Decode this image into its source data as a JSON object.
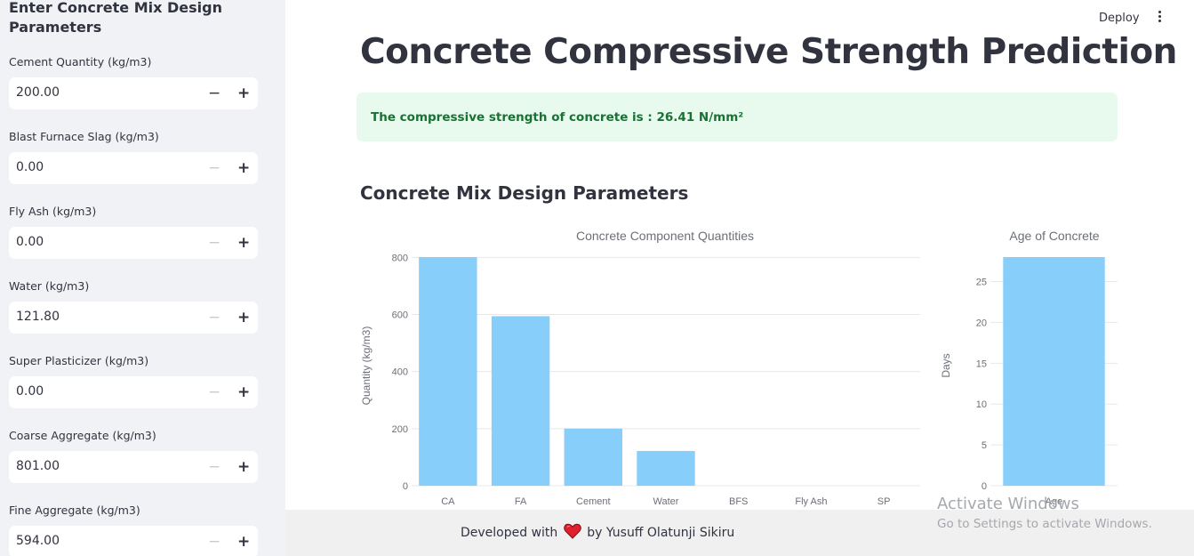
{
  "sidebar": {
    "title": "Enter Concrete Mix Design Parameters",
    "fields": [
      {
        "label": "Cement Quantity (kg/m3)",
        "value": "200.00",
        "minus": "−",
        "plus": "+"
      },
      {
        "label": "Blast Furnace Slag (kg/m3)",
        "value": "0.00",
        "minus": "−",
        "plus": "+"
      },
      {
        "label": "Fly Ash (kg/m3)",
        "value": "0.00",
        "minus": "−",
        "plus": "+"
      },
      {
        "label": "Water (kg/m3)",
        "value": "121.80",
        "minus": "−",
        "plus": "+"
      },
      {
        "label": "Super Plasticizer (kg/m3)",
        "value": "0.00",
        "minus": "−",
        "plus": "+"
      },
      {
        "label": "Coarse Aggregate (kg/m3)",
        "value": "801.00",
        "minus": "−",
        "plus": "+"
      },
      {
        "label": "Fine Aggregate (kg/m3)",
        "value": "594.00",
        "minus": "−",
        "plus": "+"
      }
    ]
  },
  "header": {
    "deploy_label": "Deploy",
    "menu_icon": "kebab-menu-icon"
  },
  "main": {
    "title": "Concrete Compressive Strength Prediction",
    "result": "The compressive strength of concrete is : 26.41 N/mm²",
    "section_title": "Concrete Mix Design Parameters"
  },
  "colors": {
    "bar": "#87cefa",
    "success_bg": "#e8f9ee",
    "success_text": "#177233",
    "sidebar_bg": "#f0f2f6"
  },
  "chart_data": [
    {
      "type": "bar",
      "title": "Concrete Component Quantities",
      "xlabel": "",
      "ylabel": "Quantity (kg/m3)",
      "categories": [
        "CA",
        "FA",
        "Cement",
        "Water",
        "BFS",
        "Fly Ash",
        "SP"
      ],
      "values": [
        801,
        594,
        200,
        121.8,
        0,
        0,
        0
      ],
      "ylim": [
        0,
        801
      ],
      "yticks": [
        0,
        200,
        400,
        600,
        800
      ],
      "grid": true
    },
    {
      "type": "bar",
      "title": "Age of Concrete",
      "xlabel": "",
      "ylabel": "Days",
      "categories": [
        "Age"
      ],
      "values": [
        28
      ],
      "ylim": [
        0,
        28
      ],
      "yticks": [
        0,
        5,
        10,
        15,
        20,
        25
      ],
      "grid": true
    }
  ],
  "footer": {
    "prefix": "Developed with",
    "suffix": "by Yusuff Olatunji Sikiru",
    "icon": "heart-icon"
  },
  "watermark": {
    "line1": "Activate Windows",
    "line2": "Go to Settings to activate Windows."
  }
}
